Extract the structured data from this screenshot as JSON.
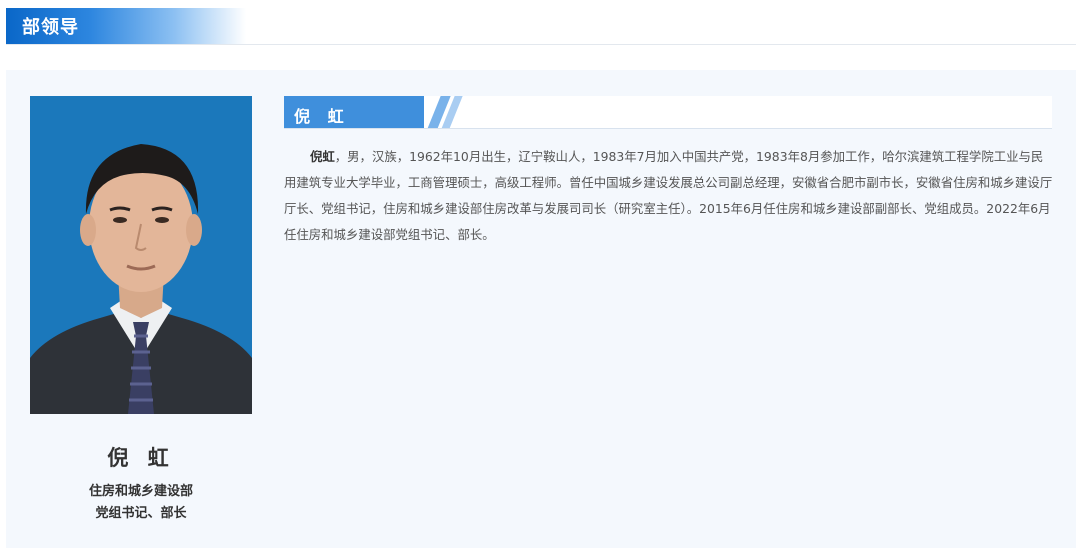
{
  "section": {
    "title": "部领导"
  },
  "profile": {
    "name": "倪 虹",
    "organization": "住房和城乡建设部",
    "position": "党组书记、部长",
    "photo_icon": "portrait-photo"
  },
  "bio": {
    "heading": "倪 虹",
    "lead_name": "倪虹",
    "text": "，男，汉族，1962年10月出生，辽宁鞍山人，1983年7月加入中国共产党，1983年8月参加工作，哈尔滨建筑工程学院工业与民用建筑专业大学毕业，工商管理硕士，高级工程师。曾任中国城乡建设发展总公司副总经理，安徽省合肥市副市长，安徽省住房和城乡建设厅厅长、党组书记，住房和城乡建设部住房改革与发展司司长（研究室主任）。2015年6月任住房和城乡建设部副部长、党组成员。2022年6月任住房和城乡建设部党组书记、部长。"
  },
  "colors": {
    "accent": "#0a67c8",
    "tab": "#3f8fdc",
    "panel_bg": "#f4f8fd"
  }
}
